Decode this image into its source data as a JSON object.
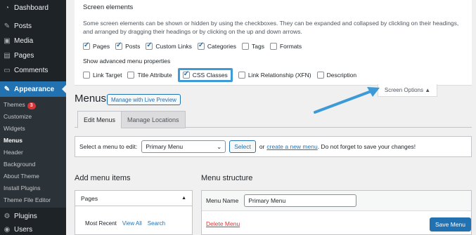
{
  "sidebar": {
    "top_items": [
      {
        "label": "Dashboard",
        "icon": "dashboard-icon",
        "glyph": "◔"
      },
      {
        "label": "Posts",
        "icon": "pin-icon",
        "glyph": "✎"
      },
      {
        "label": "Media",
        "icon": "media-icon",
        "glyph": "▣"
      },
      {
        "label": "Pages",
        "icon": "pages-icon",
        "glyph": "▤"
      },
      {
        "label": "Comments",
        "icon": "comments-icon",
        "glyph": "▭"
      }
    ],
    "appearance": {
      "label": "Appearance",
      "glyph": "✎"
    },
    "submenu": {
      "themes": "Themes",
      "themes_badge": "3",
      "customize": "Customize",
      "widgets": "Widgets",
      "menus": "Menus",
      "header": "Header",
      "background": "Background",
      "about_theme": "About Theme",
      "install_plugins": "Install Plugins",
      "theme_file_editor": "Theme File Editor"
    },
    "bottom_items": [
      {
        "label": "Plugins",
        "glyph": "⚙"
      },
      {
        "label": "Users",
        "glyph": "◉"
      }
    ]
  },
  "screen_options": {
    "title": "Screen elements",
    "description": "Some screen elements can be shown or hidden by using the checkboxes. They can be expanded and collapsed by clickling on their headings, and arranged by dragging their headings or by clicking on the up and down arrows.",
    "elements": [
      {
        "label": "Pages",
        "checked": true
      },
      {
        "label": "Posts",
        "checked": true
      },
      {
        "label": "Custom Links",
        "checked": true
      },
      {
        "label": "Categories",
        "checked": true
      },
      {
        "label": "Tags",
        "checked": false
      },
      {
        "label": "Formats",
        "checked": false
      }
    ],
    "advanced_title": "Show advanced menu properties",
    "advanced": [
      {
        "label": "Link Target",
        "checked": false
      },
      {
        "label": "Title Attribute",
        "checked": false
      },
      {
        "label": "CSS Classes",
        "checked": true
      },
      {
        "label": "Link Relationship (XFN)",
        "checked": false
      },
      {
        "label": "Description",
        "checked": false
      }
    ],
    "toggle_label": "Screen Options ▲"
  },
  "menus": {
    "title": "Menus",
    "live_preview_button": "Manage with Live Preview",
    "tabs": [
      "Edit Menus",
      "Manage Locations"
    ],
    "select_label": "Select a menu to edit:",
    "selected_menu": "Primary Menu",
    "select_button": "Select",
    "or_text": "or",
    "create_link": "create a new menu",
    "save_note": ". Do not forget to save your changes!"
  },
  "add_items": {
    "title": "Add menu items",
    "pages_label": "Pages",
    "tabs": [
      "Most Recent",
      "View All",
      "Search"
    ]
  },
  "structure": {
    "title": "Menu structure",
    "name_label": "Menu Name",
    "name_value": "Primary Menu",
    "delete_link": "Delete Menu",
    "save_button": "Save Menu"
  },
  "colors": {
    "accent": "#2271b1",
    "sidebar": "#1d2327",
    "highlight": "#3d9ad6",
    "danger": "#d63638"
  }
}
